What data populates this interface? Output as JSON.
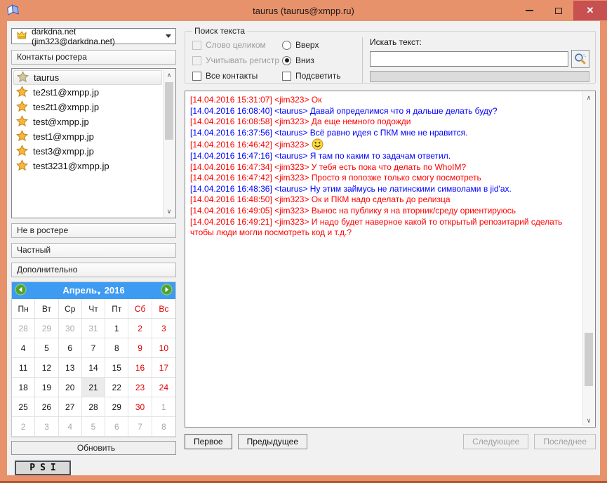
{
  "window": {
    "title": "taurus (taurus@xmpp.ru)",
    "close_glyph": "✕"
  },
  "colors": {
    "titlebar": "#e8926c",
    "close_button": "#c75050",
    "calendar_header": "#3d9bf2",
    "self_text": "#ff0000",
    "peer_text": "#0000ff",
    "weekend_text": "#e00000"
  },
  "sidebar": {
    "account": {
      "label": "darkdna.net (jim323@darkdna.net)",
      "icon": "crown-icon"
    },
    "roster_header": "Контакты ростера",
    "contacts": [
      {
        "name": "taurus",
        "selected": true
      },
      {
        "name": "te2st1@xmpp.jp",
        "selected": false
      },
      {
        "name": "tes2t1@xmpp.jp",
        "selected": false
      },
      {
        "name": "test@xmpp.jp",
        "selected": false
      },
      {
        "name": "test1@xmpp.jp",
        "selected": false
      },
      {
        "name": "test3@xmpp.jp",
        "selected": false
      },
      {
        "name": "test3231@xmpp.jp",
        "selected": false
      }
    ],
    "sections": [
      "Не в ростере",
      "Частный",
      "Дополнительно"
    ],
    "refresh_button": "Обновить",
    "logo": "PSI"
  },
  "calendar": {
    "month": "Апрель",
    "year": "2016",
    "prev_icon": "arrow-left-icon",
    "next_icon": "arrow-right-icon",
    "day_headers": [
      {
        "label": "Пн",
        "we": false
      },
      {
        "label": "Вт",
        "we": false
      },
      {
        "label": "Ср",
        "we": false
      },
      {
        "label": "Чт",
        "we": false
      },
      {
        "label": "Пт",
        "we": false
      },
      {
        "label": "Сб",
        "we": true
      },
      {
        "label": "Вс",
        "we": true
      }
    ],
    "weeks": [
      [
        {
          "d": "28",
          "t": "out"
        },
        {
          "d": "29",
          "t": "out"
        },
        {
          "d": "30",
          "t": "out"
        },
        {
          "d": "31",
          "t": "out"
        },
        {
          "d": "1",
          "t": "n"
        },
        {
          "d": "2",
          "t": "we"
        },
        {
          "d": "3",
          "t": "we"
        }
      ],
      [
        {
          "d": "4",
          "t": "n"
        },
        {
          "d": "5",
          "t": "n"
        },
        {
          "d": "6",
          "t": "n"
        },
        {
          "d": "7",
          "t": "n"
        },
        {
          "d": "8",
          "t": "n"
        },
        {
          "d": "9",
          "t": "we"
        },
        {
          "d": "10",
          "t": "we"
        }
      ],
      [
        {
          "d": "11",
          "t": "n"
        },
        {
          "d": "12",
          "t": "n"
        },
        {
          "d": "13",
          "t": "n"
        },
        {
          "d": "14",
          "t": "n"
        },
        {
          "d": "15",
          "t": "n"
        },
        {
          "d": "16",
          "t": "we"
        },
        {
          "d": "17",
          "t": "we"
        }
      ],
      [
        {
          "d": "18",
          "t": "n"
        },
        {
          "d": "19",
          "t": "n"
        },
        {
          "d": "20",
          "t": "n"
        },
        {
          "d": "21",
          "t": "today"
        },
        {
          "d": "22",
          "t": "n"
        },
        {
          "d": "23",
          "t": "we"
        },
        {
          "d": "24",
          "t": "we"
        }
      ],
      [
        {
          "d": "25",
          "t": "n"
        },
        {
          "d": "26",
          "t": "n"
        },
        {
          "d": "27",
          "t": "n"
        },
        {
          "d": "28",
          "t": "n"
        },
        {
          "d": "29",
          "t": "n"
        },
        {
          "d": "30",
          "t": "we"
        },
        {
          "d": "1",
          "t": "out"
        }
      ],
      [
        {
          "d": "2",
          "t": "out"
        },
        {
          "d": "3",
          "t": "out"
        },
        {
          "d": "4",
          "t": "out"
        },
        {
          "d": "5",
          "t": "out"
        },
        {
          "d": "6",
          "t": "out"
        },
        {
          "d": "7",
          "t": "out"
        },
        {
          "d": "8",
          "t": "out"
        }
      ]
    ]
  },
  "search": {
    "group_title": "Поиск текста",
    "options": [
      {
        "id": "whole-word",
        "label": "Слово целиком",
        "type": "checkbox",
        "checked": false,
        "disabled": true
      },
      {
        "id": "match-case",
        "label": "Учитывать регистр",
        "type": "checkbox",
        "checked": false,
        "disabled": true
      },
      {
        "id": "all-contacts",
        "label": "Все контакты",
        "type": "checkbox",
        "checked": false,
        "disabled": false
      },
      {
        "id": "direction-up",
        "label": "Вверх",
        "type": "radio",
        "checked": false,
        "disabled": false
      },
      {
        "id": "direction-down",
        "label": "Вниз",
        "type": "radio",
        "checked": true,
        "disabled": false
      },
      {
        "id": "highlight",
        "label": "Подсветить",
        "type": "checkbox",
        "checked": false,
        "disabled": false
      }
    ],
    "find_label": "Искать текст:",
    "input_value": "",
    "search_icon": "magnifier-icon"
  },
  "chat": {
    "date": "14.04.2016",
    "messages": [
      {
        "time": "14.04.2016 15:31:07",
        "nick": "jim323",
        "who": "self",
        "text": "Ок",
        "smiley": false
      },
      {
        "time": "14.04.2016 16:08:40",
        "nick": "taurus",
        "who": "peer",
        "text": "Давай определимся что я дальше делать буду?",
        "smiley": false
      },
      {
        "time": "14.04.2016 16:08:58",
        "nick": "jim323",
        "who": "self",
        "text": "Да еще немного подожди",
        "smiley": false
      },
      {
        "time": "14.04.2016 16:37:56",
        "nick": "taurus",
        "who": "peer",
        "text": "Всё равно идея с ПКМ мне не нравится.",
        "smiley": false
      },
      {
        "time": "14.04.2016 16:46:42",
        "nick": "jim323",
        "who": "self",
        "text": "",
        "smiley": true
      },
      {
        "time": "14.04.2016 16:47:16",
        "nick": "taurus",
        "who": "peer",
        "text": "Я там по каким то задачам ответил.",
        "smiley": false
      },
      {
        "time": "14.04.2016 16:47:34",
        "nick": "jim323",
        "who": "self",
        "text": "У тебя есть пока что делать по WhoIM?",
        "smiley": false
      },
      {
        "time": "14.04.2016 16:47:42",
        "nick": "jim323",
        "who": "self",
        "text": "Просто я попозже только смогу посмотреть",
        "smiley": false
      },
      {
        "time": "14.04.2016 16:48:36",
        "nick": "taurus",
        "who": "peer",
        "text": "Ну этим займусь не латинскими символами в jid'ах.",
        "smiley": false
      },
      {
        "time": "14.04.2016 16:48:50",
        "nick": "jim323",
        "who": "self",
        "text": "Ок и ПКМ надо сделать до релизца",
        "smiley": false
      },
      {
        "time": "14.04.2016 16:49:05",
        "nick": "jim323",
        "who": "self",
        "text": "Вынос на публику я на вторник/среду ориентируюсь",
        "smiley": false
      },
      {
        "time": "14.04.2016 16:49:21",
        "nick": "jim323",
        "who": "self",
        "text": "И надо будет наверное какой то открытый репозитарий сделать чтобы люди могли посмотреть код и т.д.?",
        "smiley": false
      }
    ]
  },
  "nav": {
    "first": "Первое",
    "prev": "Предыдущее",
    "next": "Следующее",
    "last": "Последнее",
    "next_disabled": true,
    "last_disabled": true
  }
}
